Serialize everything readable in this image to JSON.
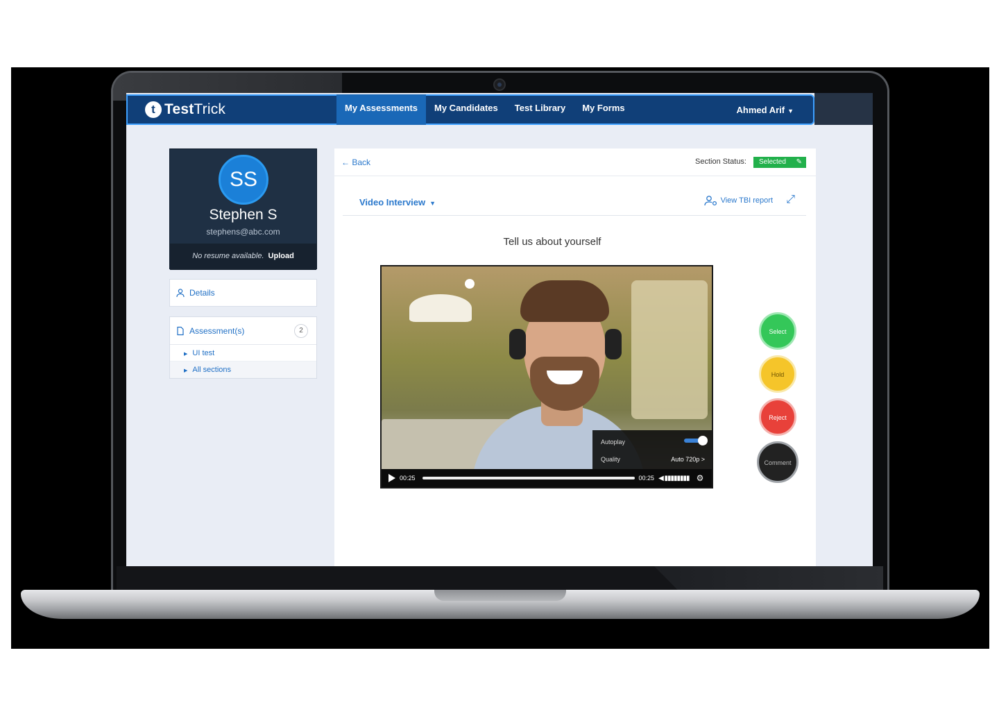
{
  "app": {
    "brand_bold": "Test",
    "brand_light": "Trick",
    "logo_letter": "t"
  },
  "nav": {
    "items": [
      "My Assessments",
      "My Candidates",
      "Test Library",
      "My Forms"
    ],
    "active_index": 0,
    "user": "Ahmed Arif"
  },
  "profile": {
    "initials": "SS",
    "name": "Stephen S",
    "email": "stephens@abc.com",
    "resume_note": "No resume available.",
    "upload_label": "Upload"
  },
  "sidebar": {
    "details_label": "Details",
    "assessments_label": "Assessment(s)",
    "assessments_count": "2",
    "sub_items": [
      "UI test",
      "All sections"
    ]
  },
  "main": {
    "back_label": "Back",
    "section_status_label": "Section Status:",
    "section_status_value": "Selected",
    "section_dropdown": "Video Interview",
    "tbi_report_label": "View TBI report",
    "question": "Tell us about yourself"
  },
  "video": {
    "autoplay_label": "Autoplay",
    "autoplay_on": true,
    "quality_label": "Quality",
    "quality_value": "Auto 720p >",
    "time_current": "00:25",
    "time_total": "00:25",
    "progress": 1.0
  },
  "actions": {
    "select": "Select",
    "hold": "Hold",
    "reject": "Reject",
    "comment": "Comment"
  },
  "colors": {
    "nav": "#103f78",
    "nav_active": "#1a68b7",
    "accent": "#2a78cc",
    "select": "#34c759",
    "hold": "#f5c52a",
    "reject": "#e8413a"
  }
}
